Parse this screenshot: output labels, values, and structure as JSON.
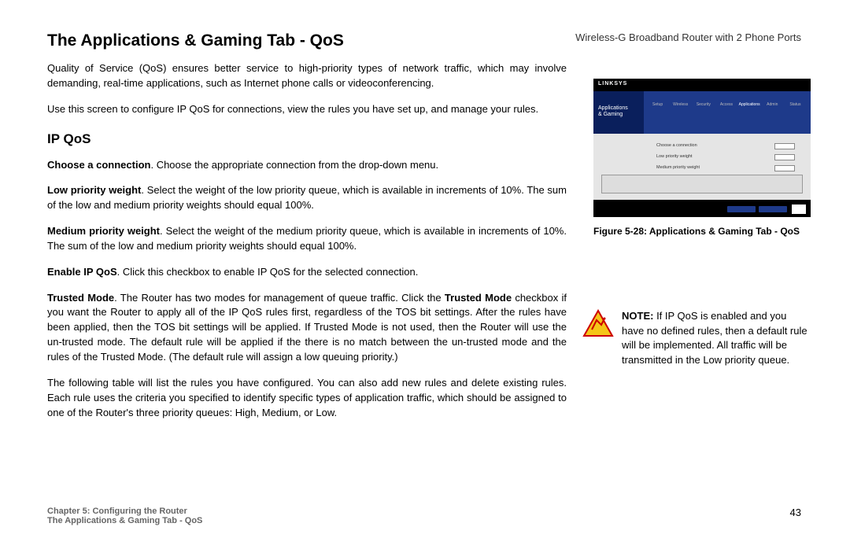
{
  "header": {
    "product": "Wireless-G Broadband Router with 2 Phone Ports"
  },
  "title": "The Applications & Gaming Tab - QoS",
  "paragraphs": {
    "intro1": "Quality of Service (QoS) ensures better service to high-priority types of network traffic, which may involve demanding, real-time applications, such as Internet phone calls or videoconferencing.",
    "intro2": "Use this screen to configure IP QoS for connections, view the rules you have set up, and manage your rules.",
    "subheading": "IP QoS",
    "choose_label": "Choose a connection",
    "choose_text": ". Choose the appropriate connection from the drop-down menu.",
    "low_label": "Low priority weight",
    "low_text": ". Select the weight of the low priority queue, which is available in increments of 10%. The sum of the low and medium priority weights should equal 100%.",
    "med_label": "Medium priority weight",
    "med_text": ". The sum of the low and medium priority weights should equal 100%.",
    "med_mid": ". Select the weight of the medium priority queue, which is available in increments of 10%. The sum of the low and medium priority weights should equal 100%.",
    "enable_label": "Enable IP QoS",
    "enable_text": ". Click this checkbox to enable IP QoS for the selected connection.",
    "trusted_label": "Trusted Mode",
    "trusted_pre": ". The Router has two modes for management of queue traffic. Click the ",
    "trusted_mid": "Trusted Mode",
    "trusted_post": " checkbox if you want the Router to apply all of the IP QoS rules first, regardless of the TOS bit settings. After the rules have been applied, then the TOS bit settings will be applied. If Trusted Mode is not used, then the Router will use the un-trusted mode. The default rule will be applied if the there is no match between the un-trusted mode and the rules of the Trusted Mode. (The default rule will assign a low queuing priority.)",
    "table_text": "The following table will list the rules you have configured. You can also add new rules and delete existing rules. Each rule uses the criteria you specified to identify specific types of application traffic, which should be assigned to one of the Router's three priority queues: High, Medium, or Low."
  },
  "figure": {
    "logo": "LINKSYS",
    "sidebar1": "Applications",
    "sidebar2": "& Gaming",
    "caption": "Figure 5-28: Applications & Gaming Tab - QoS"
  },
  "note": {
    "label": "NOTE:",
    "text": "  If IP QoS is enabled and you have no defined rules, then a default rule will be implemented. All traffic will be transmitted in the Low priority queue."
  },
  "footer": {
    "chapter": "Chapter 5: Configuring the Router",
    "section": "The Applications & Gaming Tab - QoS",
    "page": "43"
  }
}
